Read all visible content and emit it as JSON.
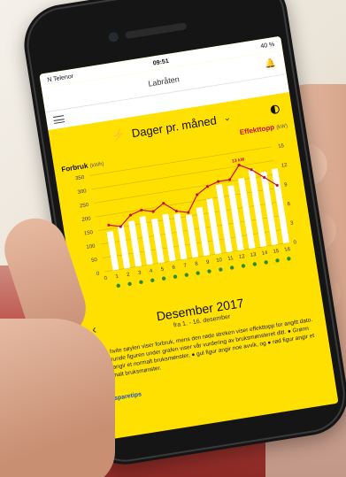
{
  "status_bar": {
    "carrier": "N Telenor",
    "time": "09:51",
    "battery": "40 %"
  },
  "app_bar": {
    "title": "Labråten"
  },
  "period_selector": {
    "label": "Dager pr. måned"
  },
  "legend": {
    "left_label": "Forbruk",
    "left_unit": "(kWh)",
    "right_label": "Effekttopp",
    "right_unit": "(kW)"
  },
  "summary": {
    "month": "Desember 2017",
    "range": "fra 1. - 16. desember",
    "description": "Den hvite søylen viser forbruk, mens den røde streken viser effekttopp for angitt dato. Den runde figuren under grafen viser vår vurdering av bruksmønsteret ditt. ● Grønn figur angir et normalt bruksmønster, ● gul figur angir noe avvik, og ● rød figur angir et unormalt bruksmønster.",
    "link": "Se sparetips"
  },
  "colors": {
    "background": "#ffe000",
    "bars": "#ffffff",
    "line": "#c8102e",
    "status_green": "#2e8b3a"
  },
  "chart_data": {
    "type": "bar",
    "categories": [
      "0",
      "1",
      "2",
      "3",
      "4",
      "5",
      "6",
      "7",
      "8",
      "9",
      "10",
      "11",
      "12",
      "13",
      "14",
      "15",
      "16"
    ],
    "series": [
      {
        "name": "Forbruk",
        "values": [
          0,
          140,
          155,
          165,
          175,
          160,
          170,
          165,
          155,
          175,
          200,
          245,
          235,
          255,
          280,
          265,
          270
        ]
      },
      {
        "name": "Effekttopp",
        "values": [
          null,
          7,
          6.5,
          8,
          8.5,
          8,
          9,
          7.5,
          7,
          9.5,
          10.5,
          11,
          11,
          13,
          12,
          10.5,
          9
        ]
      }
    ],
    "y_left": {
      "ticks": [
        0,
        50,
        100,
        150,
        200,
        250,
        300,
        350
      ],
      "ylim": [
        0,
        350
      ]
    },
    "y_right": {
      "ticks": [
        0,
        3,
        6,
        9,
        12,
        15
      ],
      "ylim": [
        0,
        15
      ]
    },
    "annotation": "13 kW",
    "pattern_indicators": [
      "",
      "normal",
      "normal",
      "normal",
      "normal",
      "normal",
      "normal",
      "normal",
      "normal",
      "normal",
      "normal",
      "normal",
      "normal",
      "normal",
      "normal",
      "normal",
      "normal"
    ]
  }
}
